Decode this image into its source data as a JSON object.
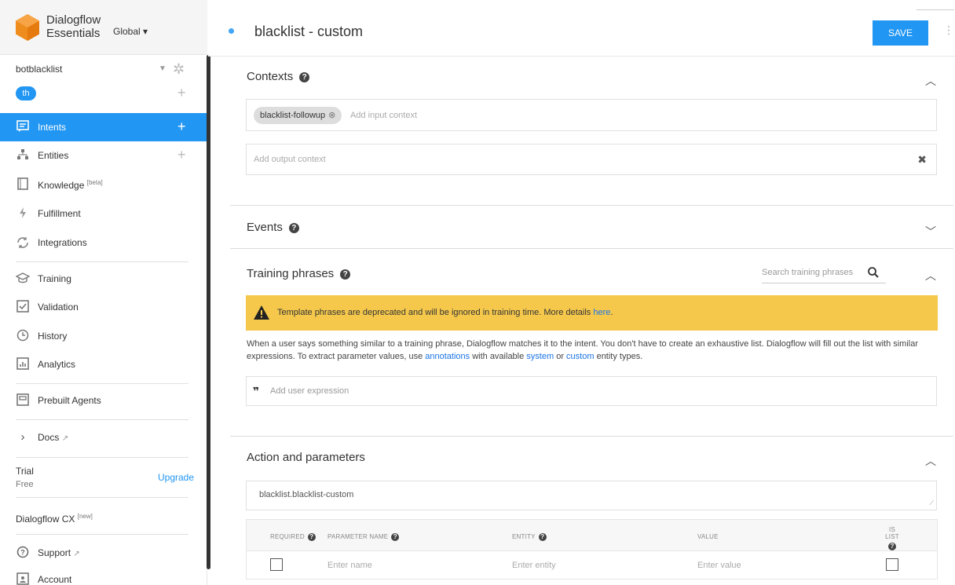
{
  "brand": {
    "name_line1": "Dialogflow",
    "name_line2": "Essentials",
    "region": "Global ▾"
  },
  "agent": {
    "name": "botblacklist",
    "language": "th"
  },
  "nav": {
    "intents": "Intents",
    "entities": "Entities",
    "knowledge": "Knowledge",
    "knowledge_tag": "[beta]",
    "fulfillment": "Fulfillment",
    "integrations": "Integrations",
    "training": "Training",
    "validation": "Validation",
    "history": "History",
    "analytics": "Analytics",
    "prebuilt": "Prebuilt Agents",
    "docs": "Docs",
    "support": "Support",
    "account": "Account"
  },
  "trial": {
    "label": "Trial",
    "plan": "Free",
    "upgrade": "Upgrade"
  },
  "cx": {
    "label": "Dialogflow CX",
    "tag": "[new]"
  },
  "header": {
    "title": "blacklist - custom",
    "save": "SAVE"
  },
  "contexts": {
    "title": "Contexts",
    "input_chip": "blacklist-followup",
    "input_placeholder": "Add input context",
    "output_placeholder": "Add output context"
  },
  "events": {
    "title": "Events"
  },
  "training": {
    "title": "Training phrases",
    "search_placeholder": "Search training phrases",
    "warning_text": "Template phrases are deprecated and will be ignored in training time. More details ",
    "warning_link": "here",
    "desc_1": "When a user says something similar to a training phrase, Dialogflow matches it to the intent. You don't have to create an exhaustive list. Dialogflow will fill out the list with similar expressions. To extract parameter values, use ",
    "desc_link_annotations": "annotations",
    "desc_2": " with available ",
    "desc_link_system": "system",
    "desc_3": " or ",
    "desc_link_custom": "custom",
    "desc_4": " entity types.",
    "expression_placeholder": "Add user expression"
  },
  "action": {
    "title": "Action and parameters",
    "value": "blacklist.blacklist-custom",
    "col_required": "REQUIRED",
    "col_name": "PARAMETER NAME",
    "col_entity": "ENTITY",
    "col_value": "VALUE",
    "col_islist_1": "IS LIST",
    "row_name_placeholder": "Enter name",
    "row_entity_placeholder": "Enter entity",
    "row_value_placeholder": "Enter value"
  },
  "colors": {
    "accent": "#2196f3",
    "warning": "#f5c84c",
    "logo": "#ef8c1e"
  }
}
